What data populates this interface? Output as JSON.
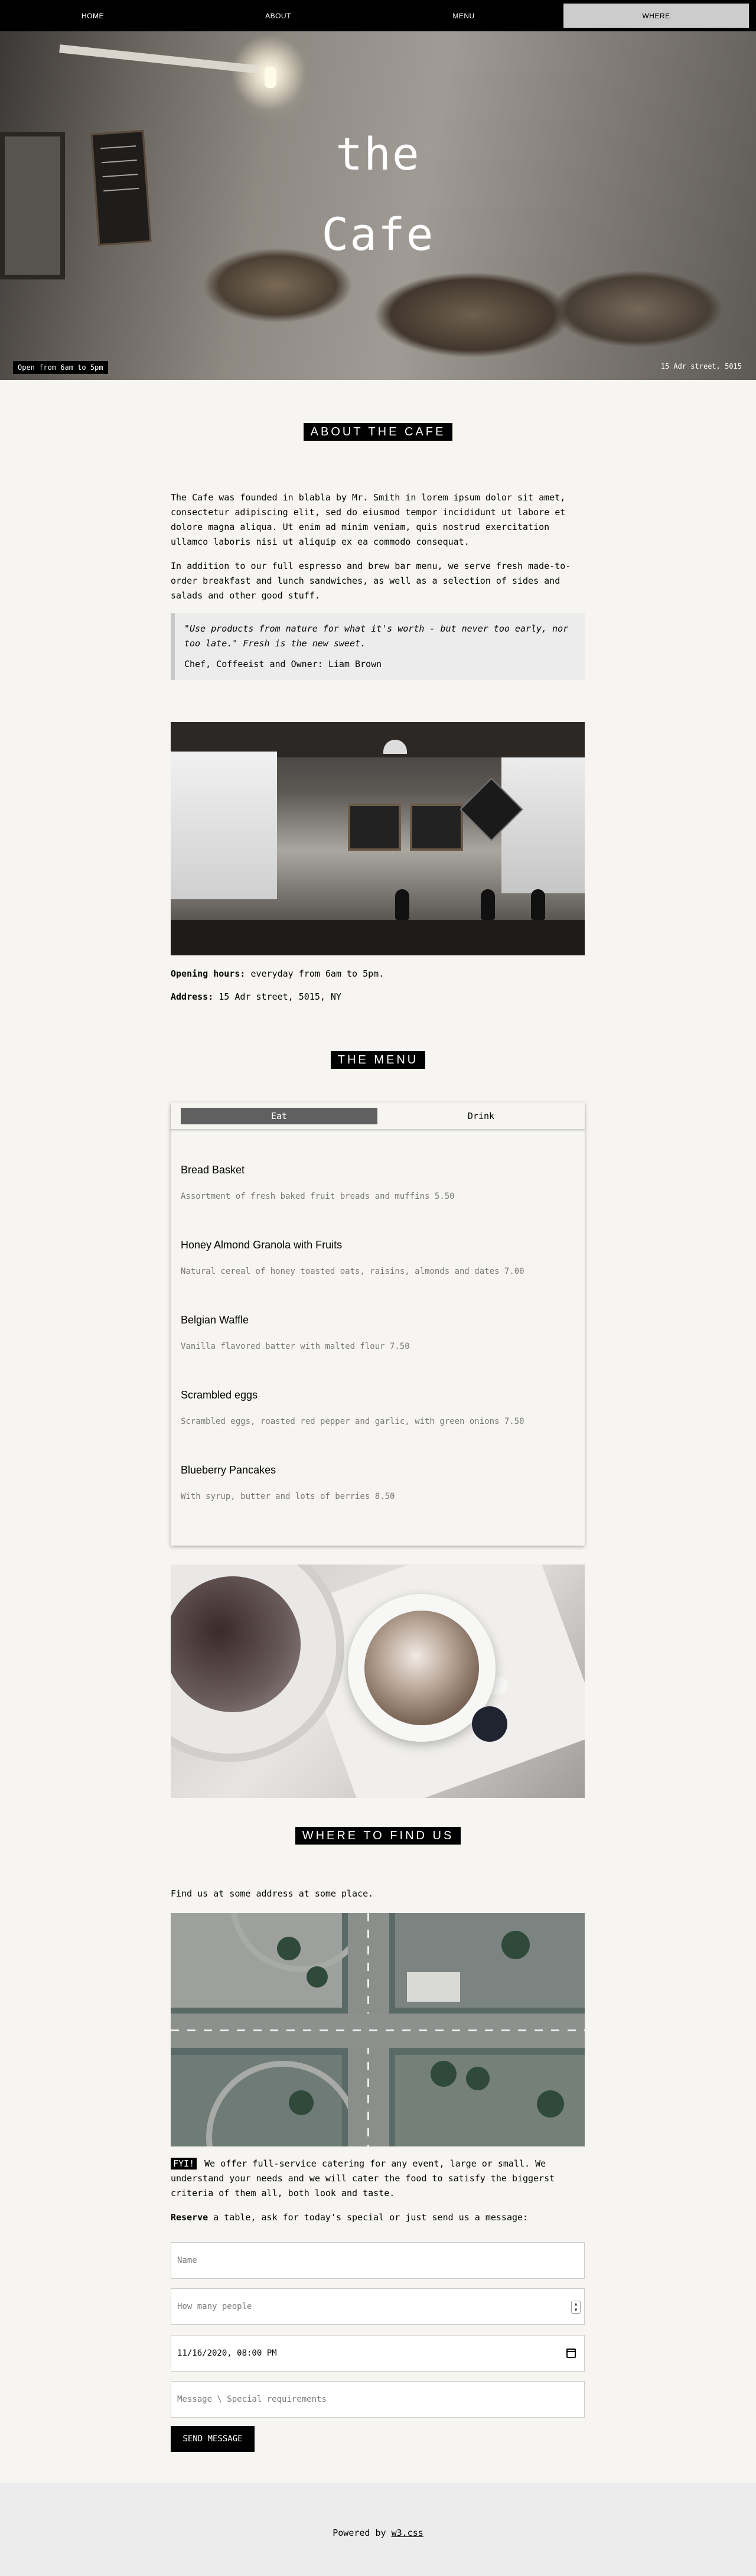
{
  "nav": {
    "items": [
      {
        "label": "HOME"
      },
      {
        "label": "ABOUT"
      },
      {
        "label": "MENU"
      },
      {
        "label": "WHERE"
      }
    ],
    "active": "WHERE"
  },
  "hero": {
    "title_line1": "the",
    "title_line2": "Cafe",
    "hours_tag": "Open from 6am to 5pm",
    "address": "15 Adr street, 5015"
  },
  "about": {
    "heading": "ABOUT THE CAFE",
    "para1": "The Cafe was founded in blabla by Mr. Smith in lorem ipsum dolor sit amet, consectetur adipiscing elit, sed do eiusmod tempor incididunt ut labore et dolore magna aliqua. Ut enim ad minim veniam, quis nostrud exercitation ullamco laboris nisi ut aliquip ex ea commodo consequat.",
    "para2": "In addition to our full espresso and brew bar menu, we serve fresh made-to-order breakfast and lunch sandwiches, as well as a selection of sides and salads and other good stuff.",
    "quote": "\"Use products from nature for what it's worth - but never too early, nor too late.\" Fresh is the new sweet.",
    "quote_author": "Chef, Coffeeist and Owner: Liam Brown",
    "hours_label": "Opening hours:",
    "hours_value": " everyday from 6am to 5pm.",
    "address_label": "Address:",
    "address_value": " 15 Adr street, 5015, NY"
  },
  "menu": {
    "heading": "THE MENU",
    "tabs": [
      {
        "label": "Eat"
      },
      {
        "label": "Drink"
      }
    ],
    "active_tab": "Eat",
    "items": [
      {
        "name": "Bread Basket",
        "desc": "Assortment of fresh baked fruit breads and muffins 5.50"
      },
      {
        "name": "Honey Almond Granola with Fruits",
        "desc": "Natural cereal of honey toasted oats, raisins, almonds and dates 7.00"
      },
      {
        "name": "Belgian Waffle",
        "desc": "Vanilla flavored batter with malted flour 7.50"
      },
      {
        "name": "Scrambled eggs",
        "desc": "Scrambled eggs, roasted red pepper and garlic, with green onions 7.50"
      },
      {
        "name": "Blueberry Pancakes",
        "desc": "With syrup, butter and lots of berries 8.50"
      }
    ]
  },
  "where": {
    "heading": "WHERE TO FIND US",
    "intro": "Find us at some address at some place.",
    "fyi_badge": "FYI!",
    "fyi_text": " We offer full-service catering for any event, large or small. We understand your needs and we will cater the food to satisfy the biggerst criteria of them all, both look and taste.",
    "reserve_bold": "Reserve",
    "reserve_text": " a table, ask for today's special or just send us a message:"
  },
  "form": {
    "name_placeholder": "Name",
    "people_placeholder": "How many people",
    "datetime_value": "11/16/2020, 08:00 PM",
    "message_placeholder": "Message \\ Special requirements",
    "send_label": "SEND MESSAGE"
  },
  "footer": {
    "prefix": "Powered by ",
    "link": "w3.css"
  }
}
